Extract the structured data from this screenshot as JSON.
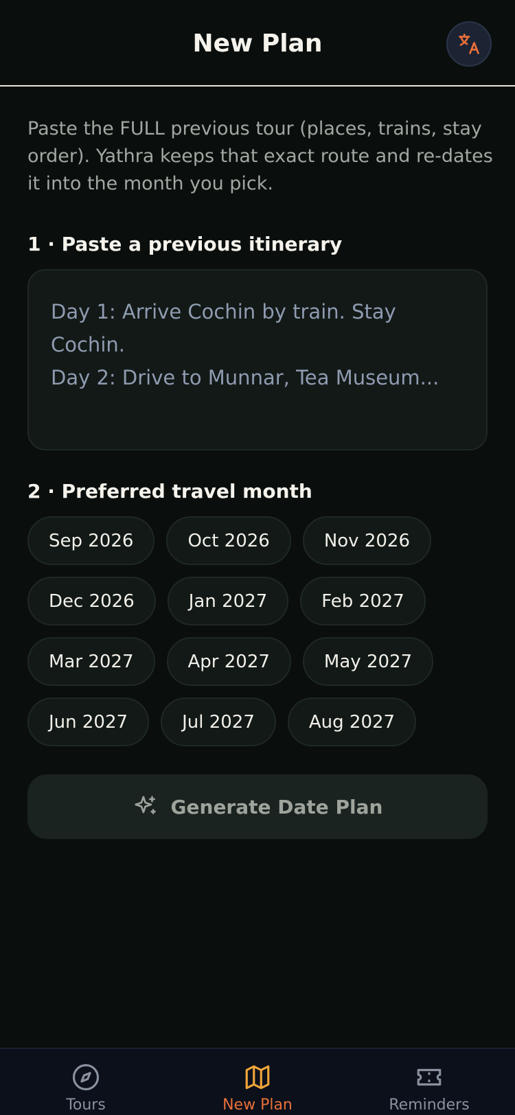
{
  "header": {
    "title": "New Plan",
    "lang_icon": "translate-icon",
    "accent": "#e8703a"
  },
  "intro": "Paste the FULL previous tour (places, trains, stay order). Yathra keeps that exact route and re-dates it into the month you pick.",
  "itinerary": {
    "title": "1 · Paste a previous itinerary",
    "placeholder": "Day 1: Arrive Cochin by train. Stay Cochin.\nDay 2: Drive to Munnar, Tea Museum...",
    "value": ""
  },
  "month": {
    "title": "2 · Preferred travel month",
    "options": [
      [
        "Sep 2026",
        "Oct 2026",
        "Nov 2026"
      ],
      [
        "Dec 2026",
        "Jan 2027",
        "Feb 2027"
      ],
      [
        "Mar 2027",
        "Apr 2027",
        "May 2027"
      ],
      [
        "Jun 2027",
        "Jul 2027",
        "Aug 2027"
      ]
    ]
  },
  "generate": {
    "label": "Generate Date Plan",
    "icon": "sparkle-icon"
  },
  "nav": {
    "active_color": "#f0a53a",
    "items": [
      {
        "label": "Tours",
        "icon": "compass-icon",
        "active": false
      },
      {
        "label": "New Plan",
        "icon": "map-icon",
        "active": true
      },
      {
        "label": "Reminders",
        "icon": "ticket-icon",
        "active": false
      }
    ]
  }
}
